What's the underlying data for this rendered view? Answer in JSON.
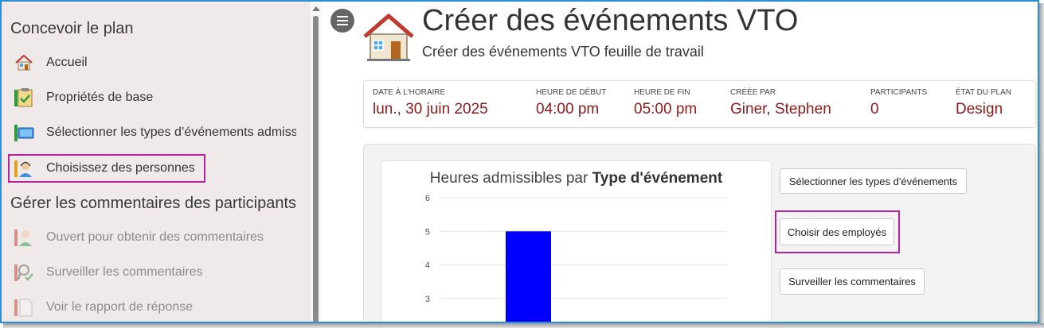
{
  "sidebar": {
    "design_title": "Concevoir le plan",
    "design_items": [
      {
        "label": "Accueil",
        "icon": "house-icon"
      },
      {
        "label": "Propriétés de base",
        "icon": "clipboard-check-icon"
      },
      {
        "label": "Sélectionner les types d’événements admissil",
        "icon": "monitor-icon"
      },
      {
        "label": "Choisissez des personnes",
        "icon": "person-headset-icon"
      }
    ],
    "feedback_title": "Gérer les commentaires des participants",
    "feedback_items": [
      {
        "label": "Ouvert pour obtenir des commentaires",
        "icon": "person-open-icon"
      },
      {
        "label": "Surveiller les commentaires",
        "icon": "magnifier-check-icon"
      },
      {
        "label": "Voir le rapport de réponse",
        "icon": "document-icon"
      }
    ]
  },
  "header": {
    "title": "Créer des événements VTO",
    "subtitle": "Créer des événements VTO feuille de travail"
  },
  "info": [
    {
      "label": "DATE À L'HORAIRE",
      "value": "lun., 30 juin 2025"
    },
    {
      "label": "HEURE DE DÉBUT",
      "value": "04:00 pm"
    },
    {
      "label": "HEURE DE FIN",
      "value": "05:00 pm"
    },
    {
      "label": "CRÉÉE PAR",
      "value": "Giner, Stephen"
    },
    {
      "label": "PARTICIPANTS",
      "value": "0"
    },
    {
      "label": "ÉTAT DU PLAN",
      "value": "Design"
    }
  ],
  "chart_data": {
    "type": "bar",
    "title_prefix": "Heures admissibles par",
    "title_bold": "Type d'événement",
    "yticks": [
      3,
      4,
      5,
      6
    ],
    "ylim": [
      2.7,
      6
    ],
    "categories": [
      ""
    ],
    "values": [
      5
    ],
    "bar_color": "#0000ff",
    "grid": true
  },
  "actions": {
    "select_types": "Sélectionner les types d'événements",
    "choose_employees": "Choisir des employés",
    "monitor_comments": "Surveiller les commentaires"
  },
  "colors": {
    "accent_value": "#8e1a1a",
    "highlight": "#b5229b",
    "frame": "#2c8fd6"
  }
}
